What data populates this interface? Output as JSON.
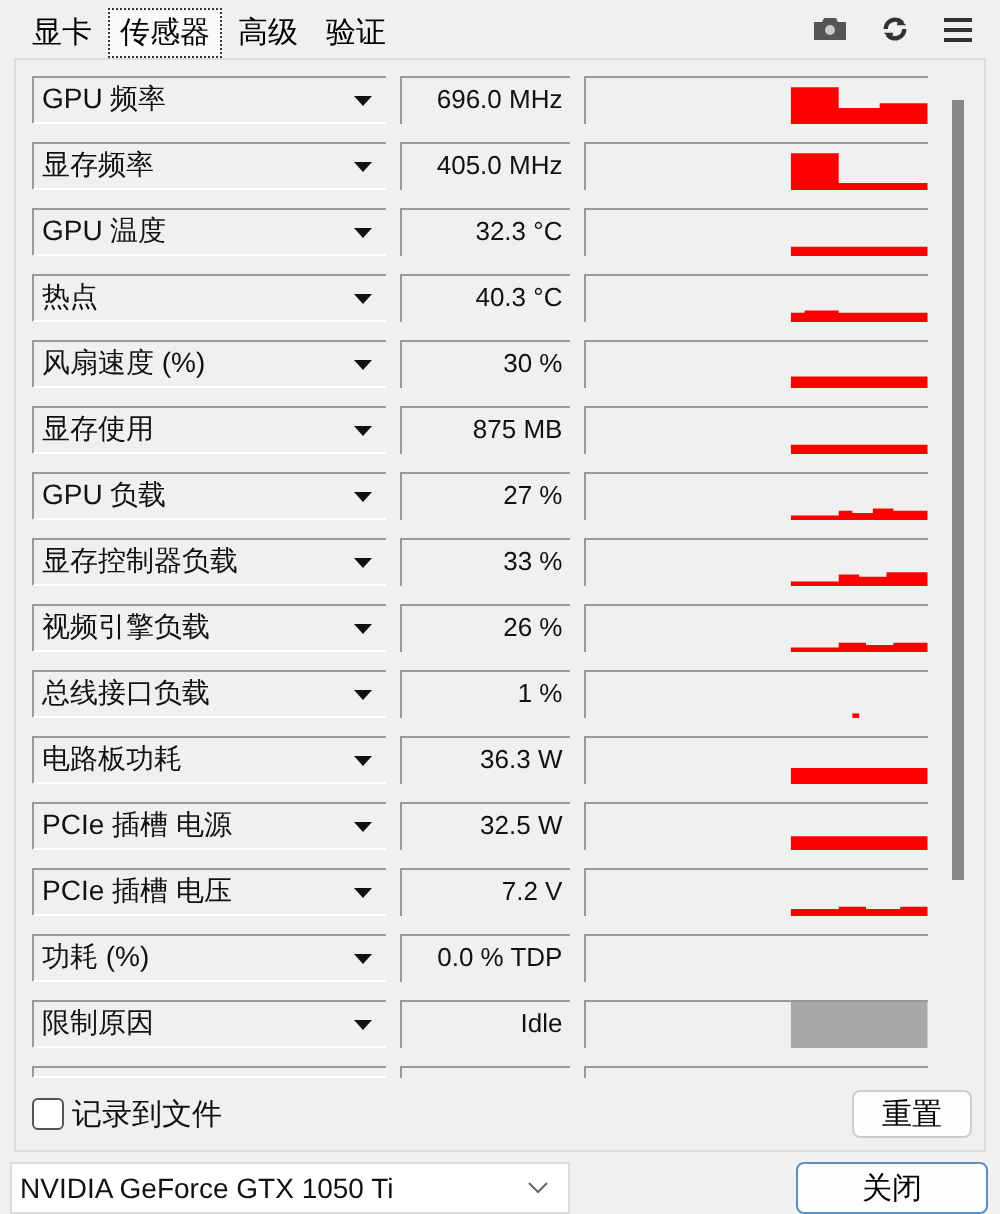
{
  "tabs": [
    {
      "label": "显卡",
      "selected": false
    },
    {
      "label": "传感器",
      "selected": true
    },
    {
      "label": "高级",
      "selected": false
    },
    {
      "label": "验证",
      "selected": false
    }
  ],
  "sensors": [
    {
      "name": "GPU 频率",
      "value": "696.0 MHz",
      "color": "#ff0000"
    },
    {
      "name": "显存频率",
      "value": "405.0 MHz",
      "color": "#ff0000"
    },
    {
      "name": "GPU 温度",
      "value": "32.3 °C",
      "color": "#ff0000"
    },
    {
      "name": "热点",
      "value": "40.3 °C",
      "color": "#ff0000"
    },
    {
      "name": "风扇速度 (%)",
      "value": "30 %",
      "color": "#ff0000"
    },
    {
      "name": "显存使用",
      "value": "875 MB",
      "color": "#ff0000"
    },
    {
      "name": "GPU 负载",
      "value": "27 %",
      "color": "#ff0000"
    },
    {
      "name": "显存控制器负载",
      "value": "33 %",
      "color": "#ff0000"
    },
    {
      "name": "视频引擎负载",
      "value": "26 %",
      "color": "#ff0000"
    },
    {
      "name": "总线接口负载",
      "value": "1 %",
      "color": "#ff0000"
    },
    {
      "name": "电路板功耗",
      "value": "36.3 W",
      "color": "#ff0000"
    },
    {
      "name": "PCIe 插槽 电源",
      "value": "32.5 W",
      "color": "#ff0000"
    },
    {
      "name": "PCIe 插槽 电压",
      "value": "7.2 V",
      "color": "#ff0000"
    },
    {
      "name": "功耗 (%)",
      "value": "0.0 % TDP"
    },
    {
      "name": "限制原因",
      "value": "Idle",
      "color": "#a8a8a8"
    }
  ],
  "log_to_file": {
    "label": "记录到文件",
    "checked": false
  },
  "reset_button": "重置",
  "gpu_select": {
    "value": "NVIDIA GeForce GTX 1050 Ti"
  },
  "close_button": "关闭"
}
